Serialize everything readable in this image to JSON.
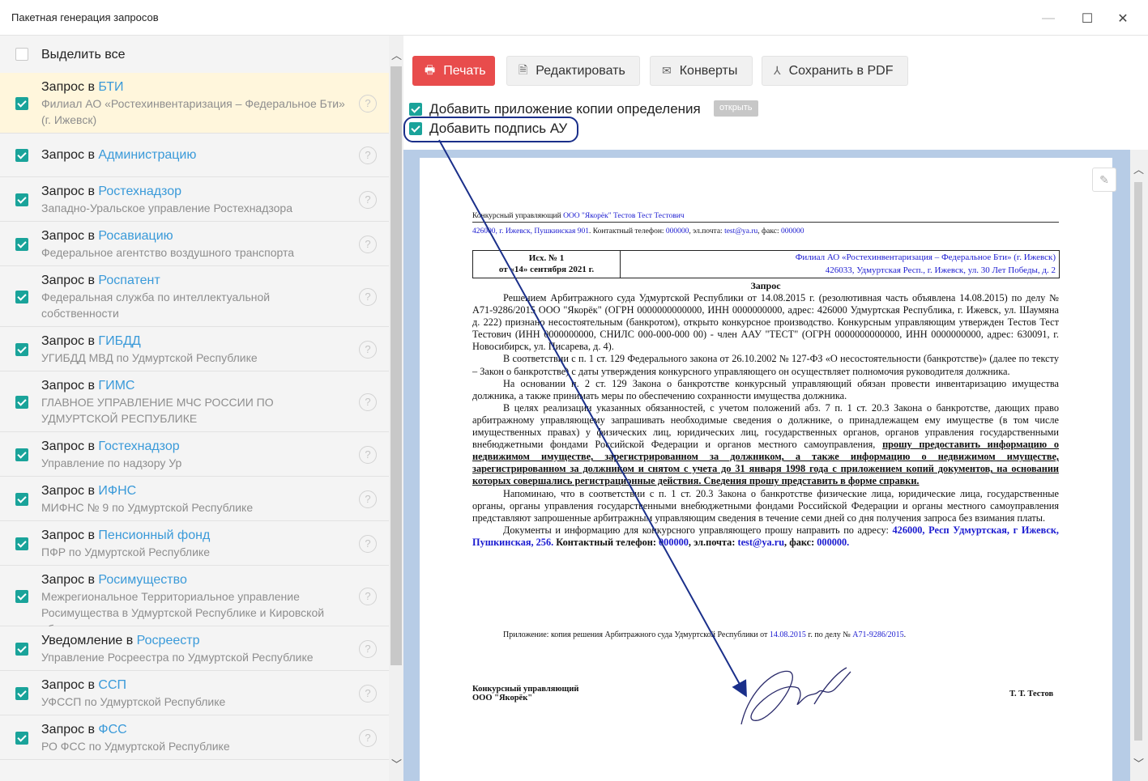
{
  "window": {
    "title": "Пакетная генерация запросов"
  },
  "select_all": {
    "label": "Выделить все"
  },
  "requests": [
    {
      "prefix": "Запрос в ",
      "org": "БТИ",
      "sub": "Филиал АО «Ростехинвентаризация – Федеральное Бти» (г. Ижевск)",
      "checked": true,
      "active": true
    },
    {
      "prefix": "Запрос в ",
      "org": "Администрацию",
      "sub": "",
      "checked": true
    },
    {
      "prefix": "Запрос в ",
      "org": "Ростехнадзор",
      "sub": "Западно-Уральское управление Ростехнадзора",
      "checked": true
    },
    {
      "prefix": "Запрос в ",
      "org": "Росавиацию",
      "sub": "Федеральное агентство воздушного транспорта",
      "checked": true
    },
    {
      "prefix": "Запрос в ",
      "org": "Роспатент",
      "sub": "Федеральная служба по интеллектуальной собственности",
      "checked": true
    },
    {
      "prefix": "Запрос в ",
      "org": "ГИБДД",
      "sub": "УГИБДД МВД по Удмуртской Республике",
      "checked": true
    },
    {
      "prefix": "Запрос в ",
      "org": "ГИМС",
      "sub": "ГЛАВНОЕ УПРАВЛЕНИЕ МЧС РОССИИ ПО УДМУРТСКОЙ РЕСПУБЛИКЕ",
      "checked": true
    },
    {
      "prefix": "Запрос в ",
      "org": "Гостехнадзор",
      "sub": "Управление по надзору Ур",
      "checked": true
    },
    {
      "prefix": "Запрос в ",
      "org": "ИФНС",
      "sub": "МИФНС № 9 по Удмуртской Республике",
      "checked": true
    },
    {
      "prefix": "Запрос в ",
      "org": "Пенсионный фонд",
      "sub": "ПФР по Удмуртской Республике",
      "checked": true
    },
    {
      "prefix": "Запрос в ",
      "org": "Росимущество",
      "sub": "Межрегиональное Территориальное управление Росимущества в Удмуртской Республике и Кировской области",
      "checked": true
    },
    {
      "prefix": "Уведомление в ",
      "org": "Росреестр",
      "sub": "Управление Росреестра по Удмуртской Республике",
      "checked": true
    },
    {
      "prefix": "Запрос в ",
      "org": "ССП",
      "sub": "УФССП по Удмуртской Республике",
      "checked": true
    },
    {
      "prefix": "Запрос в ",
      "org": "ФСС",
      "sub": "РО ФСС по Удмуртской Республике",
      "checked": true
    }
  ],
  "toolbar": {
    "print": "Печать",
    "edit": "Редактировать",
    "envelopes": "Конверты",
    "save_pdf": "Сохранить в PDF"
  },
  "options": {
    "attach_copy": "Добавить приложение копии определения",
    "open": "открыть",
    "add_signature": "Добавить подпись АУ"
  },
  "doc": {
    "hdr_prefix": "Конкурсный управляющий ",
    "hdr_company": "ООО \"Якорёк\" Тестов Тест Тестович",
    "hdr_addr": "426000, г. Ижевск, Пушкинская 901",
    "hdr_contacts_label": ". Контактный телефон: ",
    "hdr_phone": "000000",
    "hdr_mail_label": ", эл.почта: ",
    "hdr_mail": "test@ya.ru",
    "hdr_fax_label": ", факс: ",
    "hdr_fax": "000000",
    "out_no": "Исх. № 1",
    "out_date": "от «14» сентября 2021 г.",
    "to_line1": "Филиал АО «Ростехинвентаризация – Федеральное Бти» (г. Ижевск)",
    "to_line2": "426033, Удмуртская Респ., г. Ижевск, ул. 30 Лет Победы, д. 2",
    "title": "Запрос",
    "p1": "Решением Арбитражного суда Удмуртской Республики от 14.08.2015 г. (резолютивная часть объявлена 14.08.2015) по делу № А71-9286/2015 ООО \"Якорёк\" (ОГРН 0000000000000, ИНН 0000000000, адрес: 426000 Удмуртская Республика, г. Ижевск, ул. Шаумяна д. 222) признано несостоятельным (банкротом), открыто конкурсное производство. Конкурсным управляющим утвержден Тестов Тест Тестович (ИНН 0000000000, СНИЛС 000-000-000 00) - член ААУ \"ТЕСТ\" (ОГРН 0000000000000, ИНН 0000000000, адрес: 630091, г. Новосибирск, ул. Писарева, д. 4).",
    "p2": "В соответствии с п. 1 ст. 129 Федерального закона от 26.10.2002 № 127-ФЗ «О несостоятельности (банкротстве)» (далее по тексту – Закон о банкротстве) с даты утверждения конкурсного управляющего он осуществляет полномочия руководителя должника.",
    "p3": "На основании п. 2 ст. 129 Закона о банкротстве конкурсный управляющий обязан провести инвентаризацию имущества должника, а также принимать меры по обеспечению сохранности имущества должника.",
    "p4a": "В целях реализации указанных обязанностей, с учетом положений абз. 7 п. 1 ст. 20.3 Закона о банкротстве, дающих право арбитражному управляющему запрашивать необходимые сведения о должнике, о принадлежащем ему имуществе (в том числе имущественных правах) у физических лиц, юридических лиц, государственных органов, органов управления государственными внебюджетными фондами Российской Федерации и органов местного самоуправления, ",
    "p4b": "прошу предоставить информацию о недвижимом имуществе, зарегистрированном за должником, а также информацию о недвижимом имуществе, зарегистрированном за должником и снятом с учета до 31 января 1998 года с приложением копий документов, на основании которых совершались регистрационные действия. Сведения прошу представить в форме справки.",
    "p5": "Напоминаю, что в соответствии с п. 1 ст. 20.3 Закона о банкротстве физические лица, юридические лица, государственные органы, органы управления государственными внебюджетными фондами Российской Федерации и органы местного самоуправления представляют запрошенные арбитражным управляющим сведения в течение семи дней со дня получения запроса без взимания платы.",
    "p6a": "Документы и информацию для конкурсного управляющего прошу направить по адресу: ",
    "p6b": "426000, Респ Удмуртская, г Ижевск, Пушкинская, 256.",
    "p6c": " Контактный телефон: ",
    "p6d": "000000",
    "p6e": ", эл.почта: ",
    "p6f": "test@ya.ru",
    "p6g": ", факс: ",
    "p6h": "000000.",
    "app_a": "Приложение: копия решения Арбитражного суда Удмуртской Республики от ",
    "app_b": "14.08.2015",
    "app_c": " г. по делу № ",
    "app_d": "А71-9286/2015",
    "app_e": ".",
    "sig_role1": "Конкурсный управляющий",
    "sig_role2": "ООО \"Якорёк\"",
    "sig_name": "Т. Т. Тестов"
  },
  "colors": {
    "accent": "#1aa39a",
    "link": "#3a9ad9",
    "print_btn": "#e84c4c",
    "annotation": "#1a2f8a",
    "active_row": "#fff6dc"
  }
}
